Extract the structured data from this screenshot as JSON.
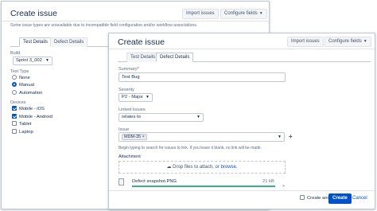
{
  "back_dialog": {
    "title": "Create issue",
    "import_label": "Import issues",
    "configure_label": "Configure fields",
    "warning": "Some issue types are unavailable due to incompatible field configuration and/or workflow associations.",
    "tabs": [
      "Test Details",
      "Defect Details"
    ],
    "build_label": "Build",
    "build_value": "Sprint 3_002",
    "test_type_label": "Test Type",
    "test_type_options": [
      {
        "label": "None",
        "checked": false
      },
      {
        "label": "Manual",
        "checked": true
      },
      {
        "label": "Automation",
        "checked": false
      }
    ],
    "devices_label": "Devices",
    "devices_options": [
      {
        "label": "Mobile - iOS",
        "checked": true
      },
      {
        "label": "Mobile - Android",
        "checked": true
      },
      {
        "label": "Tablet",
        "checked": false
      },
      {
        "label": "Laptop",
        "checked": false
      }
    ]
  },
  "front_dialog": {
    "title": "Create issue",
    "import_label": "Import issues",
    "configure_label": "Configure fields",
    "tabs": [
      "Test Details",
      "Defect Details"
    ],
    "summary_label": "Summary",
    "summary_value": "Test Bug",
    "severity_label": "Severity",
    "severity_value": "P2 - Major",
    "linked_issues_label": "Linked Issues",
    "linked_issues_value": "relates to",
    "issue_label": "Issue",
    "issue_tag": "MDM-35",
    "issue_hint": "Begin typing to search for issues to link. If you leave it blank, no link will be made.",
    "attachment_label": "Attachment",
    "drop_text": "Drop files to attach, or",
    "browse_link": "browse.",
    "file_name": "Defect snapshot.PNG",
    "file_size": "21 kB",
    "upload_progress": 1.0,
    "create_another_label": "Create another",
    "create_label": "Create",
    "cancel_label": "Cancel"
  },
  "colors": {
    "primary": "#0052cc",
    "progress": "#36b37e",
    "border": "#c1c7d0"
  }
}
